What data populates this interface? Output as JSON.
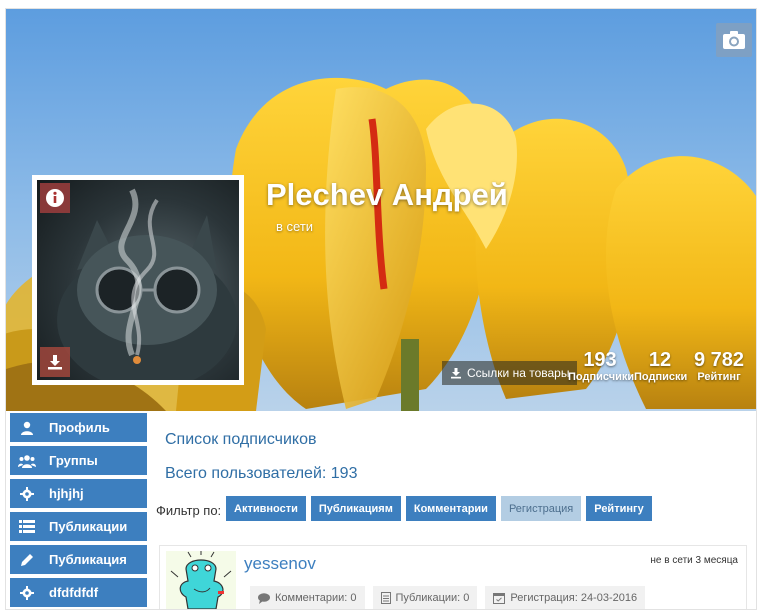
{
  "profile": {
    "name": "Plechev Андрей",
    "status": "в сети",
    "links_button": "Ссылки на товары",
    "stats": [
      {
        "value": "193",
        "label": "Подписчики"
      },
      {
        "value": "12",
        "label": "Подписки"
      },
      {
        "value": "9 782",
        "label": "Рейтинг"
      }
    ]
  },
  "sidebar": {
    "items": [
      {
        "label": "Профиль",
        "icon": "user-icon"
      },
      {
        "label": "Группы",
        "icon": "users-icon"
      },
      {
        "label": "hjhjhj",
        "icon": "gear-icon"
      },
      {
        "label": "Публикации",
        "icon": "list-icon"
      },
      {
        "label": "Публикация",
        "icon": "pencil-icon"
      },
      {
        "label": "dfdfdfdf",
        "icon": "gear-icon"
      }
    ]
  },
  "main": {
    "title": "Список подписчиков",
    "total": "Всего пользователей: 193",
    "filter_label": "Фильтр по:",
    "filters": [
      {
        "label": "Активности",
        "active": false
      },
      {
        "label": "Публикациям",
        "active": false
      },
      {
        "label": "Комментарии",
        "active": false
      },
      {
        "label": "Регистрация",
        "active": true
      },
      {
        "label": "Рейтингу",
        "active": false
      }
    ],
    "users": [
      {
        "name": "yessenov",
        "status": "не в сети 3 месяца",
        "comments": "Комментарии: 0",
        "publications": "Публикации: 0",
        "registration": "Регистрация: 24-03-2016"
      }
    ]
  },
  "colors": {
    "accent": "#3d7fbf",
    "active_filter": "#b3cde3",
    "link": "#2f6ea5"
  }
}
